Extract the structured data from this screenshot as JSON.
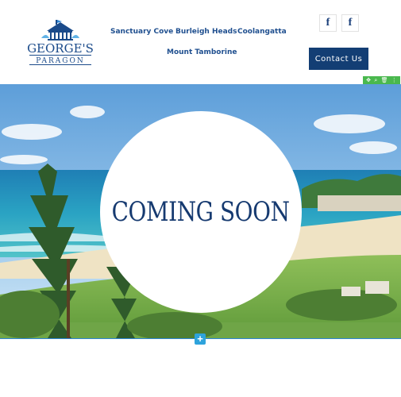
{
  "brand": {
    "name_line1": "GEORGE'S",
    "name_line2": "PARAGON"
  },
  "nav": {
    "items": [
      {
        "label": "Sanctuary Cove"
      },
      {
        "label": "Burleigh Heads"
      },
      {
        "label": "Coolangatta"
      },
      {
        "label": "Mount Tamborine"
      }
    ]
  },
  "social": [
    {
      "icon": "facebook-icon",
      "glyph": "f"
    },
    {
      "icon": "facebook-icon",
      "glyph": "f"
    }
  ],
  "header": {
    "contact_label": "Contact Us"
  },
  "editor": {
    "toolbar": [
      "✥",
      "⌕",
      "🗑",
      "⋮"
    ],
    "add_glyph": "+"
  },
  "hero": {
    "heading": "COMING SOON"
  },
  "colors": {
    "brand_blue": "#133e74",
    "nav_blue": "#1f4f8f",
    "editor_green": "#4ab84e",
    "editor_blue": "#2ea3dc"
  }
}
